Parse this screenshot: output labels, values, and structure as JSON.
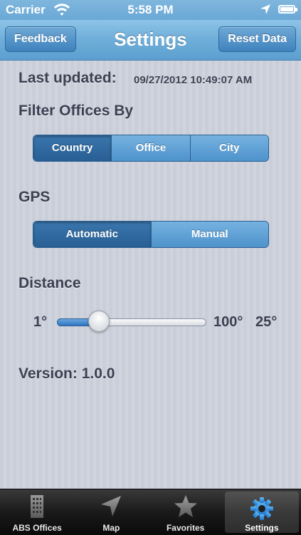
{
  "status_bar": {
    "carrier": "Carrier",
    "time": "5:58 PM",
    "icons": [
      "wifi-icon",
      "location-icon",
      "battery-icon"
    ]
  },
  "nav": {
    "title": "Settings",
    "left_button": "Feedback",
    "right_button": "Reset Data"
  },
  "settings": {
    "last_updated_label": "Last updated:",
    "last_updated_value": "09/27/2012 10:49:07 AM",
    "filter_label": "Filter Offices By",
    "filter_options": [
      "Country",
      "Office",
      "City"
    ],
    "filter_selected": "Country",
    "gps_label": "GPS",
    "gps_options": [
      "Automatic",
      "Manual"
    ],
    "gps_selected": "Automatic",
    "distance_label": "Distance",
    "distance_min": "1°",
    "distance_max": "100°",
    "distance_current": "25°",
    "distance_value": 25,
    "version": "Version: 1.0.0"
  },
  "tabs": [
    {
      "label": "ABS Offices",
      "icon": "building-icon"
    },
    {
      "label": "Map",
      "icon": "location-arrow-icon"
    },
    {
      "label": "Favorites",
      "icon": "star-icon"
    },
    {
      "label": "Settings",
      "icon": "gear-icon"
    }
  ],
  "selected_tab": "Settings",
  "colors": {
    "nav_blue": "#6eaed9",
    "segment_selected": "#285f94",
    "text": "#3a4152",
    "tab_selected_icon": "#3a9ae8"
  }
}
